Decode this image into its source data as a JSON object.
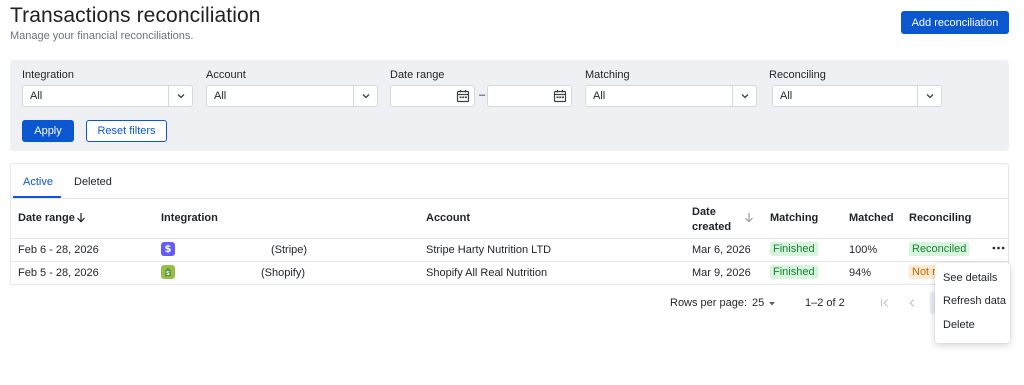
{
  "header": {
    "title": "Transactions reconciliation",
    "subtitle": "Manage your financial reconciliations.",
    "add_button_label": "Add reconciliation"
  },
  "filters": {
    "integration": {
      "label": "Integration",
      "value": "All"
    },
    "account": {
      "label": "Account",
      "value": "All"
    },
    "date_range": {
      "label": "Date range",
      "separator": "–"
    },
    "matching": {
      "label": "Matching",
      "value": "All"
    },
    "reconciling": {
      "label": "Reconciling",
      "value": "All"
    },
    "apply_label": "Apply",
    "reset_label": "Reset filters"
  },
  "tabs": [
    {
      "label": "Active",
      "active": true
    },
    {
      "label": "Deleted",
      "active": false
    }
  ],
  "table": {
    "columns": {
      "date_range": "Date range",
      "integration": "Integration",
      "account": "Account",
      "date_created": "Date created",
      "date_created_line1": "Date",
      "date_created_line2": "created",
      "matching": "Matching",
      "matched": "Matched",
      "reconciling": "Reconciling"
    },
    "rows": [
      {
        "date_range": "Feb 6 - 28, 2026",
        "integration_icon": "stripe-icon",
        "integration": "(Stripe)",
        "account": "Stripe Harty Nutrition LTD",
        "date_created": "Mar 6, 2026",
        "matching": "Finished",
        "matched": "100%",
        "reconciling": "Reconciled"
      },
      {
        "date_range": "Feb 5 - 28, 2026",
        "integration_icon": "shopify-icon",
        "integration": "(Shopify)",
        "account": "Shopify All Real Nutrition",
        "date_created": "Mar 9, 2026",
        "matching": "Finished",
        "matched": "94%",
        "reconciling": "Not r"
      }
    ]
  },
  "pagination": {
    "rows_per_page_label": "Rows per page:",
    "rows_per_page_value": "25",
    "range_text": "1–2 of 2"
  },
  "row_menu": {
    "items": [
      "See details",
      "Refresh data",
      "Delete"
    ]
  },
  "colors": {
    "primary": "#0b57d0",
    "success_bg": "#d7f5dc",
    "success_text": "#1a7f37",
    "warning_bg": "#fdebd3",
    "warning_text": "#c26a00",
    "stripe": "#635bff",
    "shopify": "#95bf47"
  }
}
